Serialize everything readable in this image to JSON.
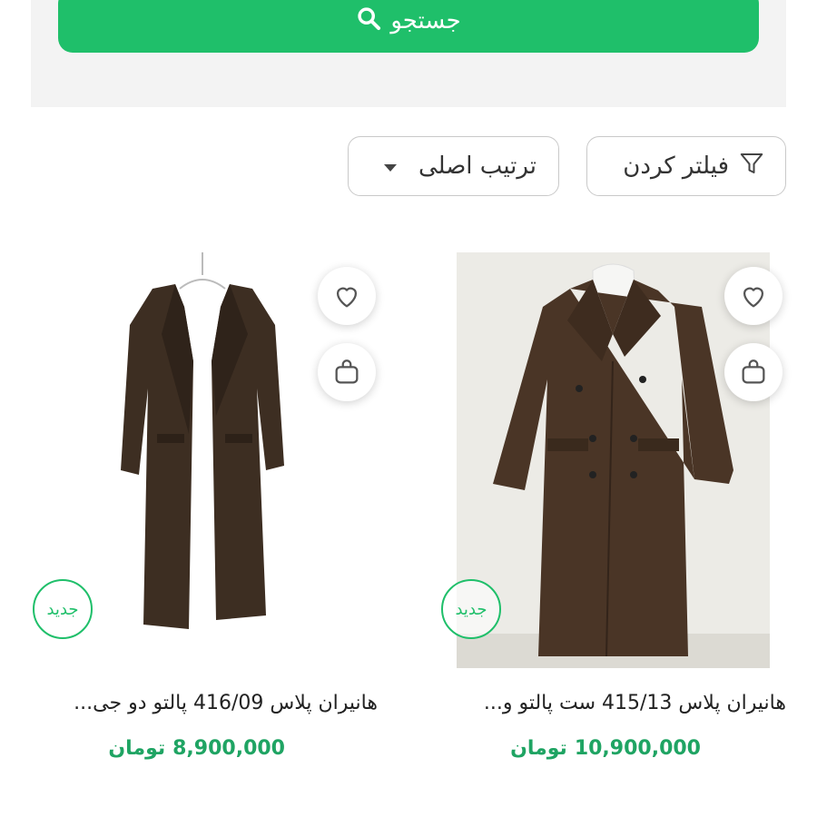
{
  "search": {
    "button_label": "جستجو",
    "icon": "search-icon"
  },
  "toolbar": {
    "filter_label": "فیلتر کردن",
    "filter_icon": "filter-icon",
    "sort_selected": "ترتیب اصلی"
  },
  "colors": {
    "accent": "#1fbf6a",
    "price": "#1fa463"
  },
  "products": [
    {
      "title": "هانیران پلاس 415/13 ست پالتو و...",
      "price": "10,900,000",
      "currency": "تومان",
      "badge": "جدید",
      "image": "brown double-breasted long coat with white hoodie"
    },
    {
      "title": "هانیران پلاس 416/09 پالتو دو جی...",
      "price": "8,900,000",
      "currency": "تومان",
      "badge": "جدید",
      "image": "brown long coat on hanger"
    }
  ]
}
